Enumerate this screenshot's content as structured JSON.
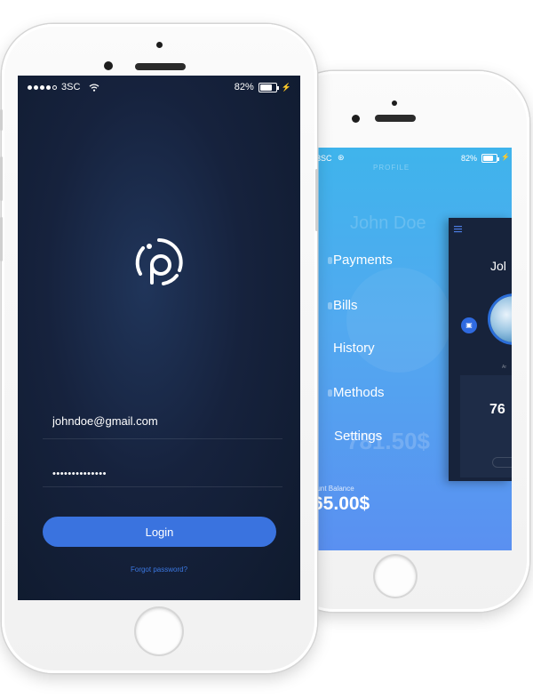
{
  "login_screen": {
    "status_bar": {
      "carrier": "3SC",
      "battery_percent": "82%",
      "battery_level": 0.82
    },
    "email_value": "johndoe@gmail.com",
    "password_value": "••••••••••••••",
    "login_label": "Login",
    "forgot_password_label": "Forgot password?"
  },
  "menu_screen": {
    "status_bar": {
      "carrier": "3SC",
      "battery_percent": "82%",
      "battery_level": 0.82
    },
    "header_caption": "PROFILE",
    "ghost_name": "John Doe",
    "ghost_amount": "781.50$",
    "menu_items": [
      {
        "label": "Payments"
      },
      {
        "label": "Bills"
      },
      {
        "label": "History"
      },
      {
        "label": "Methods"
      },
      {
        "label": "Settings"
      }
    ],
    "balance_label": "ount Balance",
    "balance_value": "65.00$",
    "panel": {
      "name": "Jol",
      "small_text": "Ar",
      "card_value": "76"
    }
  },
  "colors": {
    "primary_blue": "#3a73df",
    "dark_bg": "#16223d",
    "menu_gradient_top": "#3fb4ec",
    "menu_gradient_bottom": "#5a90f1"
  },
  "icons": [
    "signal-icon",
    "wifi-icon",
    "battery-icon",
    "charging-icon",
    "app-logo-icon",
    "menu-icon",
    "camera-icon"
  ]
}
